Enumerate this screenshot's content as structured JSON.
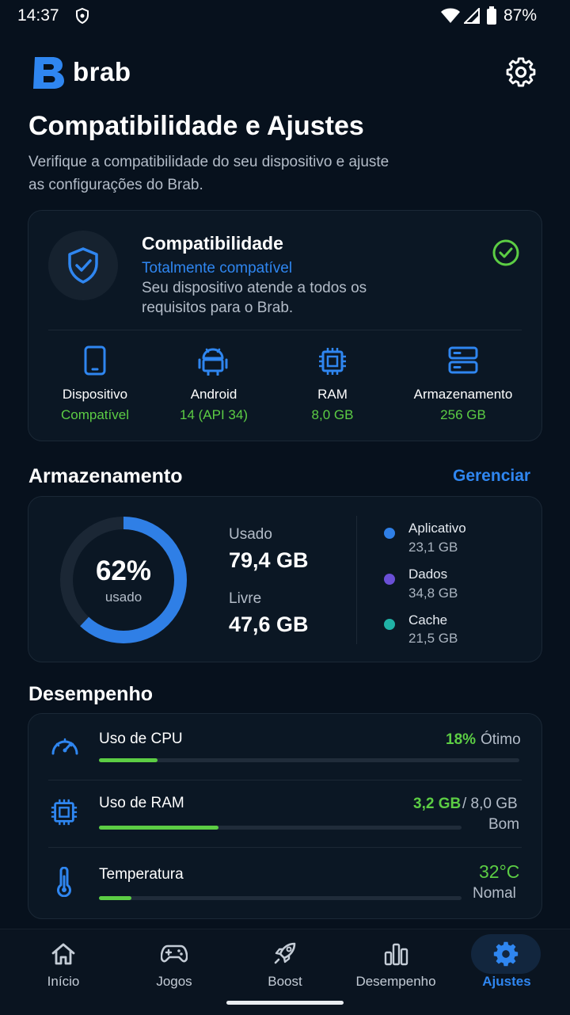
{
  "status_bar": {
    "time": "14:37",
    "battery": "87%"
  },
  "header": {
    "brand": "brab",
    "logo_letter": "B"
  },
  "page": {
    "title": "Compatibilidade e Ajustes",
    "subtitle": "Verifique a compatibilidade do seu dispositivo e ajuste as configurações do Brab."
  },
  "compat": {
    "title": "Compatibilidade",
    "status": "Totalmente compatível",
    "description": "Seu dispositivo atende a todos os requisitos para o Brab.",
    "specs": [
      {
        "label": "Dispositivo",
        "value": "Compatível"
      },
      {
        "label": "Android",
        "value": "14 (API 34)"
      },
      {
        "label": "RAM",
        "value": "8,0 GB"
      },
      {
        "label": "Armazenamento",
        "value": "256 GB"
      }
    ]
  },
  "storage": {
    "title": "Armazenamento",
    "manage": "Gerenciar",
    "percent": "62%",
    "percent_value": 0.62,
    "percent_caption": "usado",
    "used_label": "Usado",
    "used_value": "79,4 GB",
    "free_label": "Livre",
    "free_value": "47,6 GB",
    "legend": [
      {
        "name": "Aplicativo",
        "value": "23,1 GB",
        "color": "#2f7fe6"
      },
      {
        "name": "Dados",
        "value": "34,8 GB",
        "color": "#6a4fd6"
      },
      {
        "name": "Cache",
        "value": "21,5 GB",
        "color": "#20b2a6"
      }
    ],
    "ring_color": "#2f7fe6"
  },
  "performance": {
    "title": "Desempenho",
    "cpu": {
      "label": "Uso de CPU",
      "value": "18%",
      "rating": "Ótimo",
      "fraction": 0.14
    },
    "ram": {
      "label": "Uso de RAM",
      "used": "3,2 GB",
      "separator": "/ 8,0 GB",
      "rating": "Bom",
      "fraction": 0.33
    },
    "temp": {
      "label": "Temperatura",
      "value": "32°C",
      "rating": "Nomal",
      "fraction": 0.09
    }
  },
  "nav": {
    "items": [
      "Início",
      "Jogos",
      "Boost",
      "Desempenho",
      "Ajustes"
    ],
    "active": "Ajustes"
  },
  "colors": {
    "accent": "#2f86f0",
    "success": "#5ccd44",
    "background": "#07111d"
  }
}
